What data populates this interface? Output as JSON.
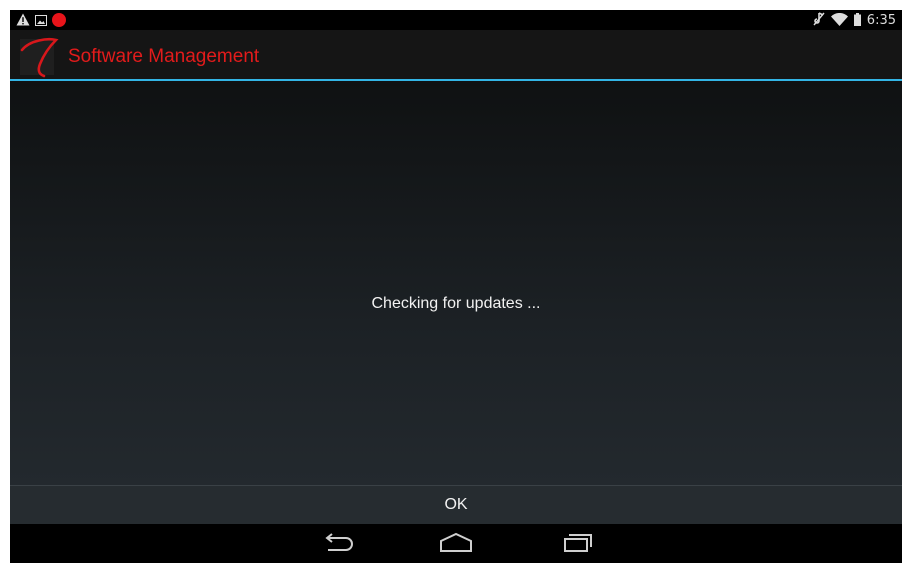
{
  "status_bar": {
    "left_icons": [
      "warning-icon",
      "picture-icon",
      "recording-dot-icon"
    ],
    "right_icons": [
      "mute-icon",
      "wifi-icon",
      "battery-icon"
    ],
    "clock": "6:35"
  },
  "action_bar": {
    "logo_icon": "app-logo-icon",
    "title": "Software Management",
    "title_color": "#e21b1b",
    "divider_color": "#33b5e5"
  },
  "content": {
    "message": "Checking for updates ..."
  },
  "dialog": {
    "ok_label": "OK"
  },
  "nav_bar": {
    "buttons": [
      "back-icon",
      "home-icon",
      "recent-apps-icon"
    ]
  }
}
